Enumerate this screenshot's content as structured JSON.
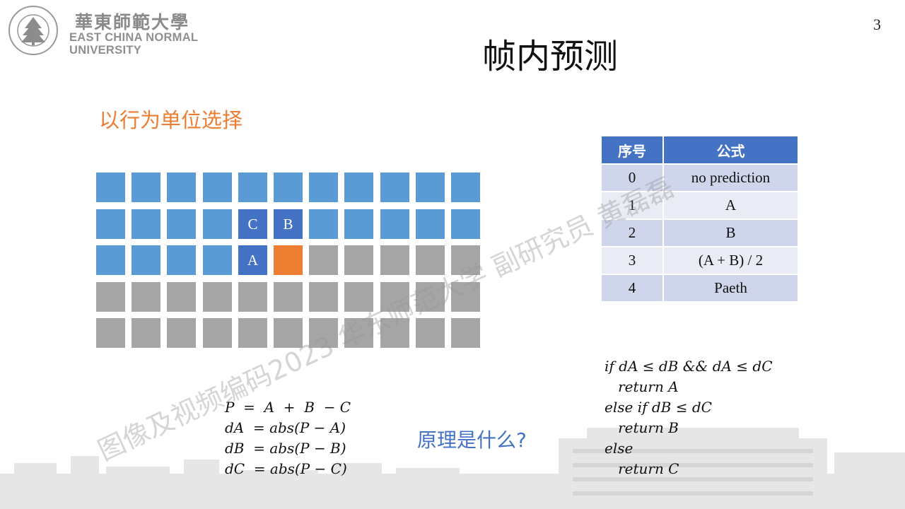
{
  "page": {
    "number": "3",
    "title": "帧内预测",
    "subtitle": "以行为单位选择",
    "question": "原理是什么?"
  },
  "logo": {
    "chinese": "華東師範大學",
    "english_line1": "EAST CHINA NORMAL",
    "english_line2": "UNIVERSITY",
    "seal_text": "EAST CHINA NORMAL UNIVERSITY"
  },
  "grid": {
    "rows": [
      [
        {
          "c": "blue",
          "t": ""
        },
        {
          "c": "blue",
          "t": ""
        },
        {
          "c": "blue",
          "t": ""
        },
        {
          "c": "blue",
          "t": ""
        },
        {
          "c": "blue",
          "t": ""
        },
        {
          "c": "blue",
          "t": ""
        },
        {
          "c": "blue",
          "t": ""
        },
        {
          "c": "blue",
          "t": ""
        },
        {
          "c": "blue",
          "t": ""
        },
        {
          "c": "blue",
          "t": ""
        },
        {
          "c": "blue",
          "t": ""
        }
      ],
      [
        {
          "c": "blue",
          "t": ""
        },
        {
          "c": "blue",
          "t": ""
        },
        {
          "c": "blue",
          "t": ""
        },
        {
          "c": "blue",
          "t": ""
        },
        {
          "c": "dark",
          "t": "C"
        },
        {
          "c": "dark",
          "t": "B"
        },
        {
          "c": "blue",
          "t": ""
        },
        {
          "c": "blue",
          "t": ""
        },
        {
          "c": "blue",
          "t": ""
        },
        {
          "c": "blue",
          "t": ""
        },
        {
          "c": "blue",
          "t": ""
        }
      ],
      [
        {
          "c": "blue",
          "t": ""
        },
        {
          "c": "blue",
          "t": ""
        },
        {
          "c": "blue",
          "t": ""
        },
        {
          "c": "blue",
          "t": ""
        },
        {
          "c": "dark",
          "t": "A"
        },
        {
          "c": "orange",
          "t": ""
        },
        {
          "c": "gray",
          "t": ""
        },
        {
          "c": "gray",
          "t": ""
        },
        {
          "c": "gray",
          "t": ""
        },
        {
          "c": "gray",
          "t": ""
        },
        {
          "c": "gray",
          "t": ""
        }
      ],
      [
        {
          "c": "gray",
          "t": ""
        },
        {
          "c": "gray",
          "t": ""
        },
        {
          "c": "gray",
          "t": ""
        },
        {
          "c": "gray",
          "t": ""
        },
        {
          "c": "gray",
          "t": ""
        },
        {
          "c": "gray",
          "t": ""
        },
        {
          "c": "gray",
          "t": ""
        },
        {
          "c": "gray",
          "t": ""
        },
        {
          "c": "gray",
          "t": ""
        },
        {
          "c": "gray",
          "t": ""
        },
        {
          "c": "gray",
          "t": ""
        }
      ],
      [
        {
          "c": "gray",
          "t": ""
        },
        {
          "c": "gray",
          "t": ""
        },
        {
          "c": "gray",
          "t": ""
        },
        {
          "c": "gray",
          "t": ""
        },
        {
          "c": "gray",
          "t": ""
        },
        {
          "c": "gray",
          "t": ""
        },
        {
          "c": "gray",
          "t": ""
        },
        {
          "c": "gray",
          "t": ""
        },
        {
          "c": "gray",
          "t": ""
        },
        {
          "c": "gray",
          "t": ""
        },
        {
          "c": "gray",
          "t": ""
        }
      ]
    ]
  },
  "table": {
    "headers": [
      "序号",
      "公式"
    ],
    "rows": [
      {
        "index": "0",
        "formula": "no prediction"
      },
      {
        "index": "1",
        "formula": "A"
      },
      {
        "index": "2",
        "formula": "B"
      },
      {
        "index": "3",
        "formula": "(A + B) / 2"
      },
      {
        "index": "4",
        "formula": "Paeth"
      }
    ]
  },
  "formulas": [
    "P  =  A  +  B  − C",
    "dA  = abs(P − A)",
    "dB  = abs(P − B)",
    "dC  = abs(P − C)"
  ],
  "algorithm": [
    "if dA ≤ dB && dA ≤ dC",
    "   return A",
    "else if dB ≤ dC",
    "   return B",
    "else",
    "   return C"
  ],
  "watermark": "图像及视频编码2023 华东师范大学 副研究员 黄磊磊",
  "colors": {
    "blue": "#5B9BD5",
    "dark": "#4472C4",
    "orange": "#ED7D31",
    "gray": "#A5A5A5",
    "table_header": "#4472C4"
  }
}
